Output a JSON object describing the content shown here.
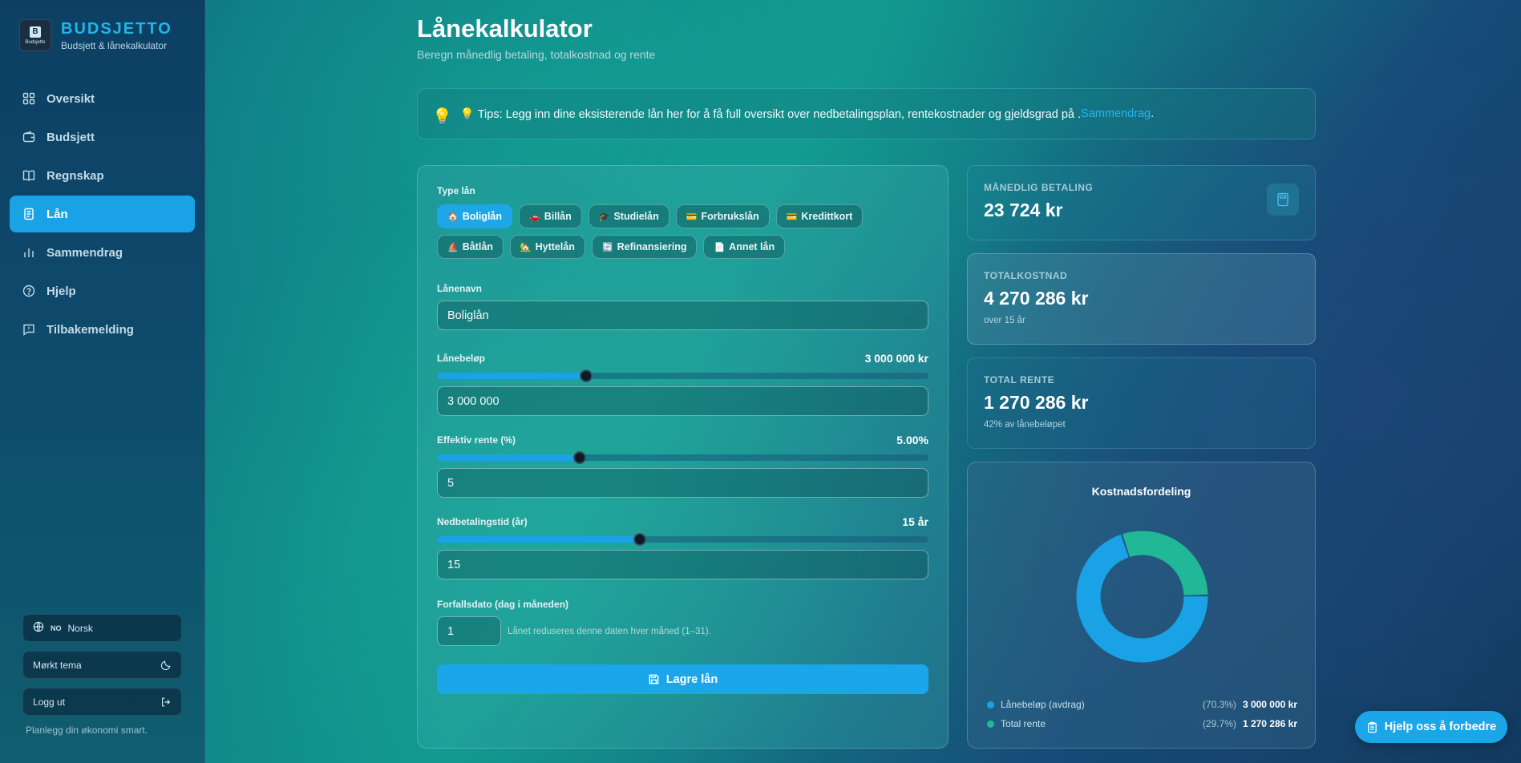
{
  "brand": {
    "name": "BUDSJETTO",
    "subtitle": "Budsjett & lånekalkulator",
    "logo_text": "Budsjetto"
  },
  "nav": [
    {
      "label": "Oversikt",
      "icon": "grid-icon"
    },
    {
      "label": "Budsjett",
      "icon": "wallet-icon"
    },
    {
      "label": "Regnskap",
      "icon": "book-icon"
    },
    {
      "label": "Lån",
      "icon": "receipt-icon",
      "active": true
    },
    {
      "label": "Sammendrag",
      "icon": "bar-chart-icon"
    },
    {
      "label": "Hjelp",
      "icon": "help-circle-icon"
    },
    {
      "label": "Tilbakemelding",
      "icon": "message-icon"
    }
  ],
  "sidebar_bottom": {
    "language_code": "NO",
    "language": "Norsk",
    "theme": "Mørkt tema",
    "logout": "Logg ut",
    "tagline": "Planlegg din økonomi smart."
  },
  "page": {
    "title": "Lånekalkulator",
    "subtitle": "Beregn månedlig betaling, totalkostnad og rente"
  },
  "tip": {
    "text": "💡 Tips: Legg inn dine eksisterende lån her for å få full oversikt over nedbetalingsplan, rentekostnader og gjeldsgrad på . ",
    "link": "Sammendrag",
    "end": "."
  },
  "form": {
    "type_label": "Type lån",
    "types": [
      {
        "emoji": "🏠",
        "label": "Boliglån",
        "active": true
      },
      {
        "emoji": "🚗",
        "label": "Billån"
      },
      {
        "emoji": "🎓",
        "label": "Studielån"
      },
      {
        "emoji": "💳",
        "label": "Forbrukslån"
      },
      {
        "emoji": "💳",
        "label": "Kredittkort"
      },
      {
        "emoji": "⛵",
        "label": "Båtlån"
      },
      {
        "emoji": "🏡",
        "label": "Hyttelån"
      },
      {
        "emoji": "🔄",
        "label": "Refinansiering"
      },
      {
        "emoji": "📄",
        "label": "Annet lån"
      }
    ],
    "name_label": "Lånenavn",
    "name_value": "Boliglån",
    "amount_label": "Lånebeløp",
    "amount_display": "3 000 000 kr",
    "amount_value": "3 000 000",
    "amount_slider": 0.303,
    "rate_label": "Effektiv rente (%)",
    "rate_display": "5.00%",
    "rate_value": "5",
    "rate_slider": 0.291,
    "term_label": "Nedbetalingstid (år)",
    "term_display": "15 år",
    "term_value": "15",
    "term_slider": 0.412,
    "due_label": "Forfallsdato (dag i måneden)",
    "due_value": "1",
    "due_hint": "Lånet reduseres denne daten hver måned (1–31).",
    "save_label": "Lagre lån"
  },
  "stats": {
    "monthly_label": "MÅNEDLIG BETALING",
    "monthly_value": "23 724 kr",
    "total_label": "TOTALKOSTNAD",
    "total_value": "4 270 286 kr",
    "total_sub": "over 15 år",
    "interest_label": "TOTAL RENTE",
    "interest_value": "1 270 286 kr",
    "interest_sub": "42% av lånebeløpet"
  },
  "chart_data": {
    "type": "pie",
    "title": "Kostnadsfordeling",
    "categories": [
      "Lånebeløp (avdrag)",
      "Total rente"
    ],
    "values": [
      3000000,
      1270286
    ],
    "percent_labels": [
      "(70.3%)",
      "(29.7%)"
    ],
    "value_labels": [
      "3 000 000 kr",
      "1 270 286 kr"
    ],
    "colors": [
      "#19a3e6",
      "#20b896"
    ],
    "legend": "bottom"
  },
  "help_button": "Hjelp oss å forbedre",
  "colors": {
    "accent": "#19a3e6",
    "green": "#20b896"
  }
}
